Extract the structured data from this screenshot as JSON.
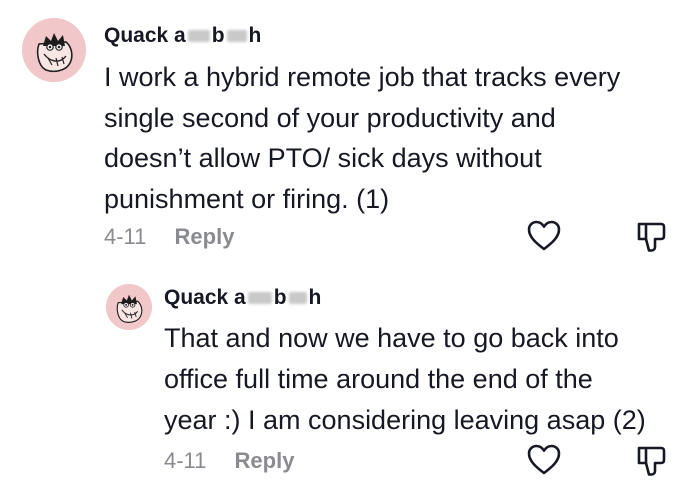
{
  "comments": [
    {
      "username_start": "Quack a",
      "username_mid": "b",
      "username_end": "h",
      "lines": [
        "I work a hybrid remote job that tracks every",
        "single second of your productivity and",
        "doesn’t allow PTO/ sick days without",
        "punishment or firing. (1)"
      ],
      "date": "4-11",
      "reply_label": "Reply",
      "avatar_icon": "duck-bag-avatar-icon",
      "like_icon": "heart-outline-icon",
      "dislike_icon": "thumbs-down-icon"
    },
    {
      "username_start": "Quack a",
      "username_mid": "b",
      "username_end": "h",
      "lines": [
        "That and now we have to go back into",
        "office full time around the end of the",
        "year :) I am considering leaving asap (2)"
      ],
      "date": "4-11",
      "reply_label": "Reply",
      "avatar_icon": "duck-bag-avatar-icon",
      "like_icon": "heart-outline-icon",
      "dislike_icon": "thumbs-down-icon"
    }
  ],
  "colors": {
    "text": "#161823",
    "secondary": "#8a8b91",
    "avatar_bg": "#f2c7c9",
    "icon_stroke": "#161823"
  }
}
